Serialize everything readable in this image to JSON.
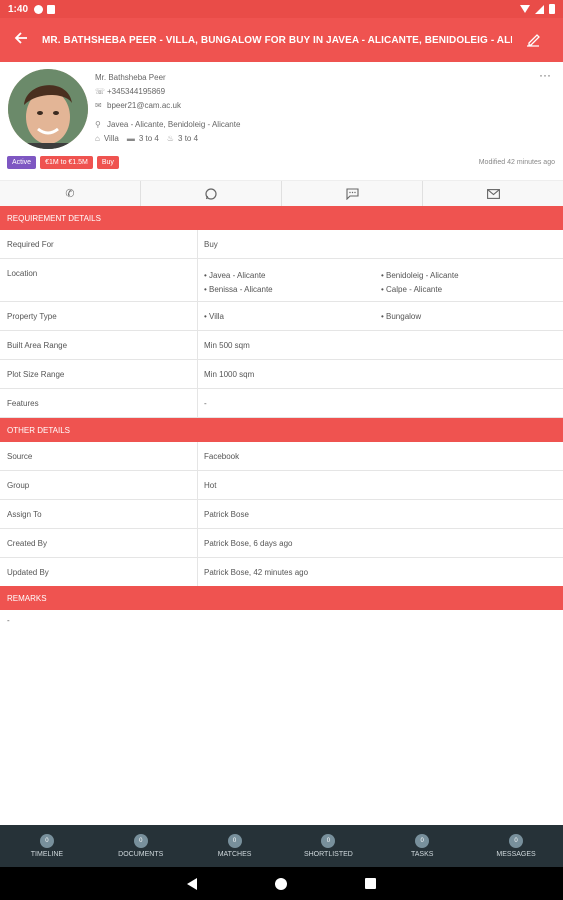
{
  "status": {
    "time": "1:40"
  },
  "appbar": {
    "title": "MR. BATHSHEBA PEER - VILLA, BUNGALOW FOR BUY IN JAVEA - ALICANTE, BENIDOLEIG - ALICANTE, B..."
  },
  "profile": {
    "name": "Mr. Bathsheba Peer",
    "phone": "+345344195869",
    "email": "bpeer21@cam.ac.uk",
    "location": "Javea - Alicante, Benidoleig - Alicante",
    "property_type": "Villa",
    "beds": "3 to 4",
    "baths": "3 to 4",
    "badges": [
      "Active",
      "€1M to €1.5M",
      "Buy"
    ],
    "modified": "Modified 42 minutes ago"
  },
  "requirement": {
    "header": "REQUIREMENT DETAILS",
    "required_for": {
      "label": "Required For",
      "value": "Buy"
    },
    "location": {
      "label": "Location",
      "col1": [
        "• Javea - Alicante",
        "• Benissa - Alicante"
      ],
      "col2": [
        "• Benidoleig - Alicante",
        "• Calpe - Alicante"
      ]
    },
    "property_type": {
      "label": "Property Type",
      "col1": "• Villa",
      "col2": "• Bungalow"
    },
    "built_area": {
      "label": "Built Area Range",
      "value": "Min 500 sqm"
    },
    "plot_size": {
      "label": "Plot Size Range",
      "value": "Min 1000 sqm"
    },
    "features": {
      "label": "Features",
      "value": "-"
    }
  },
  "other": {
    "header": "OTHER DETAILS",
    "source": {
      "label": "Source",
      "value": "Facebook"
    },
    "group": {
      "label": "Group",
      "value": "Hot"
    },
    "assign_to": {
      "label": "Assign To",
      "value": "Patrick Bose"
    },
    "created_by": {
      "label": "Created By",
      "value": "Patrick Bose, 6 days ago"
    },
    "updated_by": {
      "label": "Updated By",
      "value": "Patrick Bose, 42 minutes ago"
    }
  },
  "remarks": {
    "header": "REMARKS",
    "value": "-"
  },
  "tabs": [
    {
      "label": "TIMELINE",
      "count": "0"
    },
    {
      "label": "DOCUMENTS",
      "count": "0"
    },
    {
      "label": "MATCHES",
      "count": "0"
    },
    {
      "label": "SHORTLISTED",
      "count": "0"
    },
    {
      "label": "TASKS",
      "count": "0"
    },
    {
      "label": "MESSAGES",
      "count": "0"
    }
  ],
  "colors": {
    "primary": "#ef5350",
    "active_badge": "#7e57c2",
    "tabbar": "#263238"
  },
  "icons": {
    "back": "arrow-left-icon",
    "edit": "edit-hand-icon",
    "phone": "phone-icon",
    "whatsapp": "whatsapp-icon",
    "sms": "chat-bubble-icon",
    "email": "envelope-icon"
  }
}
